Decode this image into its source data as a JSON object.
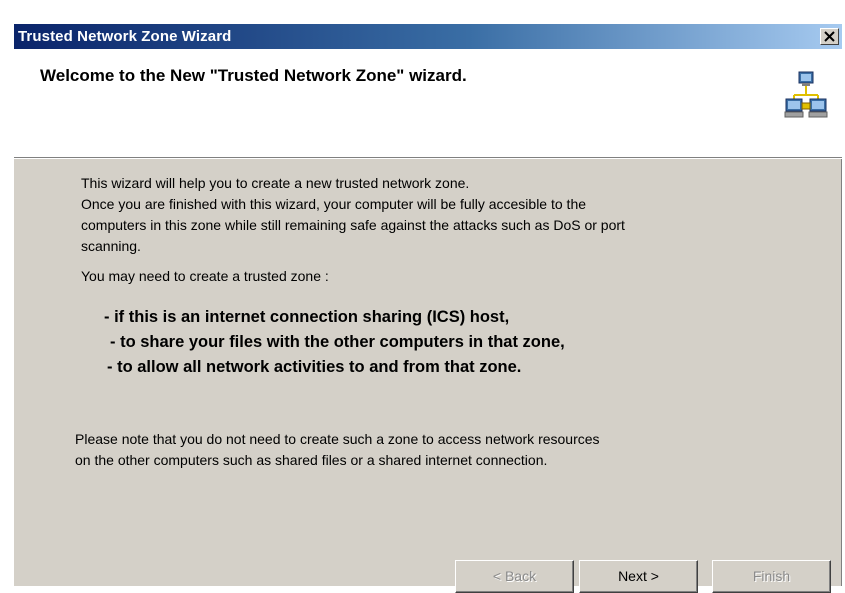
{
  "window": {
    "title": "Trusted Network Zone Wizard"
  },
  "header": {
    "title": "Welcome to the New \"Trusted Network Zone\" wizard.",
    "icon": "network-computers-icon"
  },
  "body": {
    "intro_line1": "This wizard will help you to create a new trusted network zone.",
    "intro_line2": "Once you are finished with this wizard, your computer will be fully accesible to the",
    "intro_line3": "computers in this zone while still remaining safe against the attacks such as DoS or port",
    "intro_line4": "scanning.",
    "need_text": "You may need to create a trusted zone :",
    "bullets": [
      "- if this is an internet connection sharing (ICS) host,",
      "- to share your files with the other computers in that zone,",
      "- to allow all network activities to and from that zone."
    ],
    "note_line1": "Please note that you do not need to create such a zone to access network resources",
    "note_line2": "on the other computers such as shared files or a shared internet connection."
  },
  "buttons": {
    "back": "< Back",
    "next": "Next >",
    "finish": "Finish"
  },
  "colors": {
    "titlebar_start": "#0a246a",
    "titlebar_end": "#a6caf0",
    "dialog_bg": "#d4d0c8"
  }
}
